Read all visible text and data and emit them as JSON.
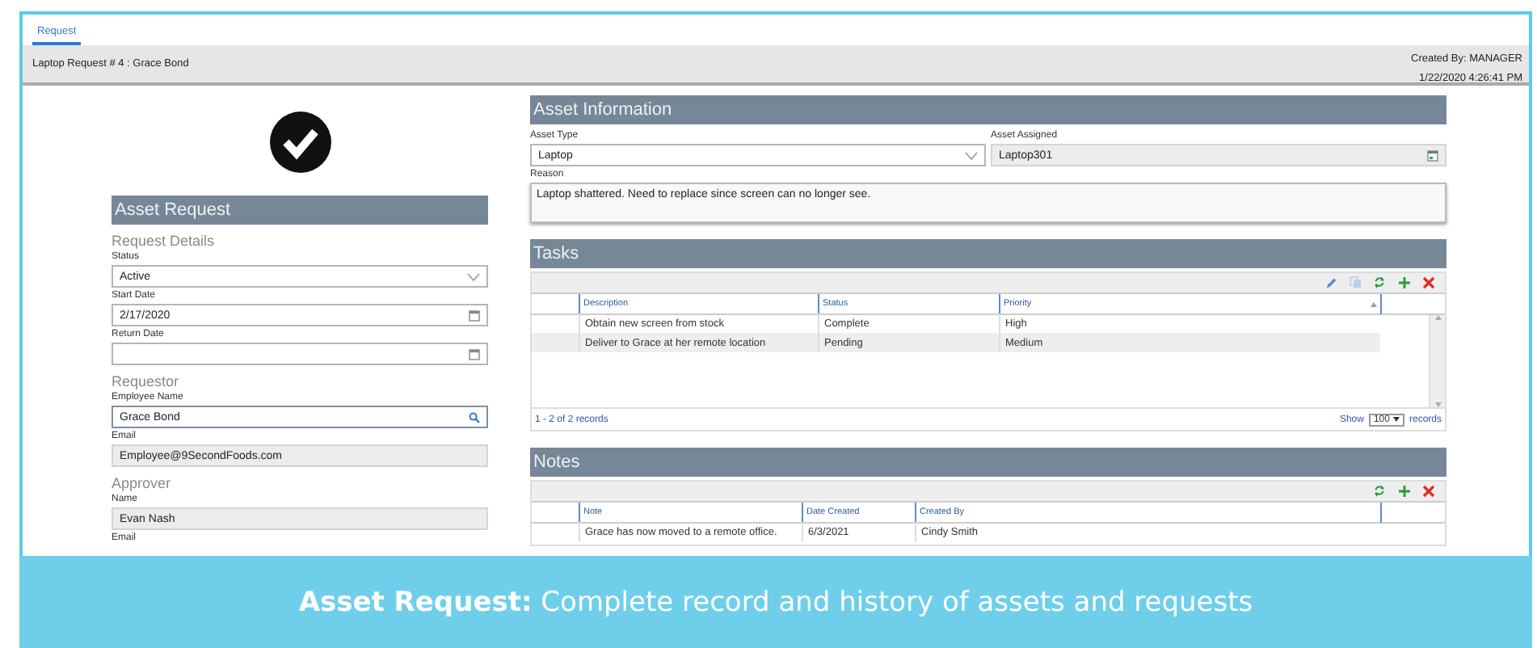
{
  "tabs": [
    {
      "label": "Request",
      "selected": true
    }
  ],
  "header": {
    "title": "Laptop Request # 4 : Grace Bond",
    "created_by": "Created By: MANAGER",
    "created_at": "1/22/2020 4:26:41 PM"
  },
  "asset_request": {
    "title": "Asset Request",
    "sections": [
      {
        "title": "Request Details",
        "fields": [
          {
            "label": "Status",
            "value": "Active",
            "kind": "dropdown"
          },
          {
            "label": "Start Date",
            "value": "2/17/2020",
            "kind": "date"
          },
          {
            "label": "Return Date",
            "kind": "date"
          }
        ]
      },
      {
        "title": "Requestor",
        "fields": [
          {
            "label": "Employee Name",
            "value": "Grace Bond",
            "kind": "lookup"
          },
          {
            "label": "Email",
            "value": "Employee@9SecondFoods.com",
            "kind": "readonly"
          }
        ]
      },
      {
        "title": "Approver",
        "fields": [
          {
            "label": "Name",
            "value": "Evan Nash",
            "kind": "readonly"
          },
          {
            "label": "Email",
            "kind": "label"
          }
        ]
      }
    ]
  },
  "asset_information": {
    "title": "Asset Information",
    "fields": [
      {
        "label": "Asset Type",
        "value": "Laptop",
        "kind": "dropdown"
      },
      {
        "label": "Asset Assigned",
        "value": "Laptop301",
        "kind": "picker"
      }
    ],
    "reason": {
      "label": "Reason",
      "value": "Laptop shattered. Need to replace since screen can no longer see."
    }
  },
  "tasks": {
    "title": "Tasks",
    "toolbar": [
      {
        "kind": "edit",
        "disabled": false
      },
      {
        "kind": "copy",
        "disabled": true
      },
      {
        "kind": "refresh",
        "disabled": false
      },
      {
        "kind": "add",
        "disabled": false
      },
      {
        "kind": "delete",
        "disabled": false
      }
    ],
    "columns": [
      {
        "label": "Description",
        "sorted": false
      },
      {
        "label": "Status",
        "sorted": false
      },
      {
        "label": "Priority",
        "sorted": true
      }
    ],
    "rows": [
      [
        "Obtain new screen from stock",
        "Complete",
        "High"
      ],
      [
        "Deliver to Grace at her remote location",
        "Pending",
        "Medium"
      ]
    ],
    "count": "1 - 2 of 2 records",
    "show_label": "Show",
    "page_size": "100",
    "records_label": "records"
  },
  "notes": {
    "title": "Notes",
    "toolbar": [
      {
        "kind": "refresh",
        "disabled": false
      },
      {
        "kind": "add",
        "disabled": false
      },
      {
        "kind": "delete",
        "disabled": false
      }
    ],
    "columns": [
      {
        "label": "Note",
        "sorted": false
      },
      {
        "label": "Date Created",
        "sorted": false
      },
      {
        "label": "Created By",
        "sorted": false
      }
    ],
    "rows": [
      [
        "Grace has now moved to a remote office.",
        "6/3/2021",
        "Cindy Smith"
      ]
    ]
  },
  "banner": "**Asset Request:** Complete record and history of assets and requests"
}
